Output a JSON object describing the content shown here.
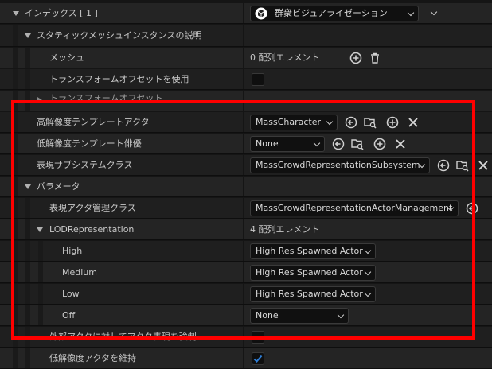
{
  "rows": {
    "index": {
      "label": "インデックス [ 1 ]",
      "combo": "群衆ビジュアライゼーション"
    },
    "static_mesh": {
      "label": "スタティックメッシュインスタンスの説明"
    },
    "mesh": {
      "label": "メッシュ",
      "value": "0 配列エレメント"
    },
    "use_transform": {
      "label": "トランスフォームオフセットを使用"
    },
    "transform_offset": {
      "label": "トランスフォームオフセット"
    },
    "hi_res_template": {
      "label": "高解像度テンプレートアクタ",
      "combo": "MassCharacter"
    },
    "lo_res_template": {
      "label": "低解像度テンプレート俳優",
      "combo": "None"
    },
    "subsystem": {
      "label": "表現サブシステムクラス",
      "combo": "MassCrowdRepresentationSubsystem"
    },
    "params": {
      "label": "パラメータ"
    },
    "actor_mgmt": {
      "label": "表現アクタ管理クラス",
      "combo": "MassCrowdRepresentationActorManagement"
    },
    "lod": {
      "label": "LODRepresentation",
      "value": "4 配列エレメント"
    },
    "high": {
      "label": "High",
      "combo": "High Res Spawned Actor"
    },
    "medium": {
      "label": "Medium",
      "combo": "High Res Spawned Actor"
    },
    "low": {
      "label": "Low",
      "combo": "High Res Spawned Actor"
    },
    "off": {
      "label": "Off",
      "combo": "None"
    },
    "force_actor": {
      "label": "外部アクタに対してアクタ表現を強制"
    },
    "keep_low_res": {
      "label": "低解像度アクタを維持"
    }
  },
  "colors": {
    "highlight": "#ff0000",
    "accent": "#2f7fd8"
  }
}
